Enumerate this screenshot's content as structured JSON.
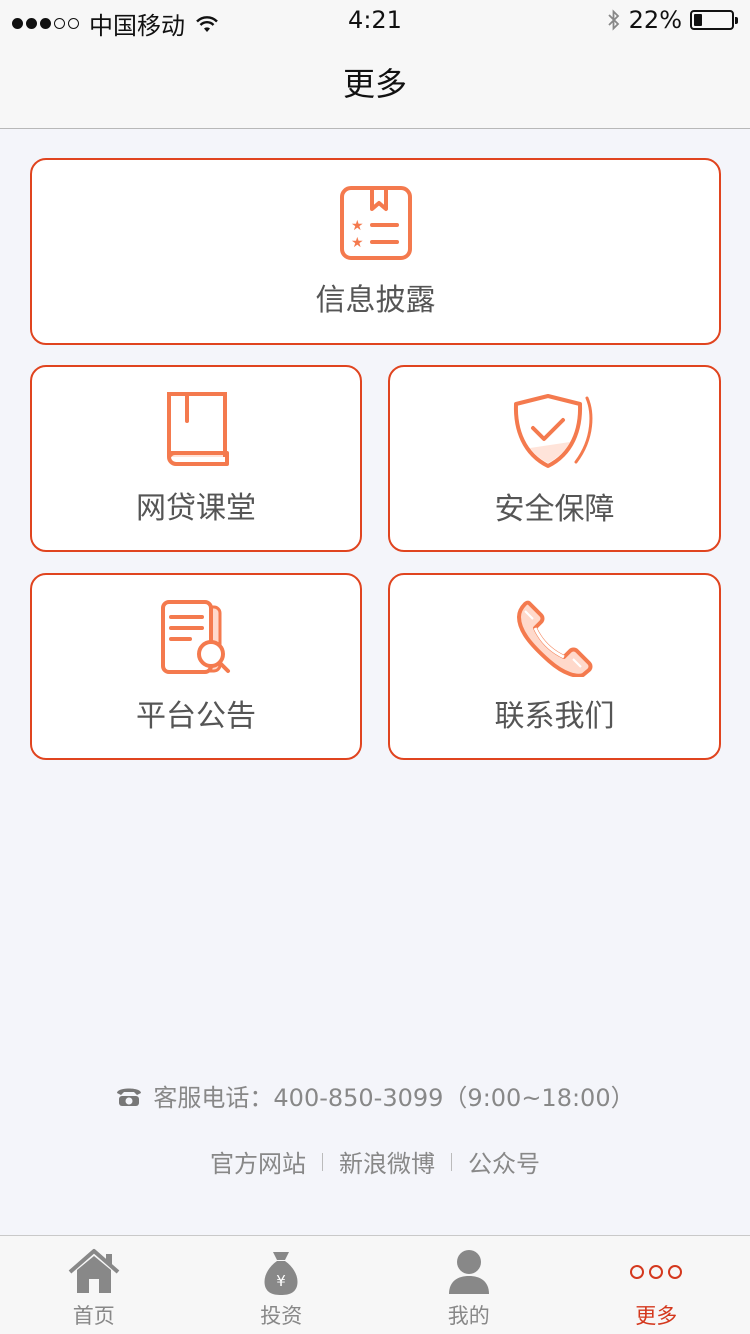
{
  "status_bar": {
    "carrier": "中国移动",
    "time": "4:21",
    "battery": "22%",
    "battery_level": 0.22
  },
  "nav": {
    "title": "更多"
  },
  "cards": {
    "disclosure": {
      "label": "信息披露",
      "icon": "disclosure-document-icon"
    },
    "classroom": {
      "label": "网贷课堂",
      "icon": "book-icon"
    },
    "security": {
      "label": "安全保障",
      "icon": "shield-check-icon"
    },
    "announcement": {
      "label": "平台公告",
      "icon": "document-search-icon"
    },
    "contact": {
      "label": "联系我们",
      "icon": "phone-icon"
    }
  },
  "footer": {
    "hotline": "客服电话：400-850-3099（9:00~18:00）",
    "links": [
      "官方网站",
      "新浪微博",
      "公众号"
    ]
  },
  "tabs": [
    {
      "label": "首页",
      "icon": "home-icon"
    },
    {
      "label": "投资",
      "icon": "money-bag-icon"
    },
    {
      "label": "我的",
      "icon": "user-icon"
    },
    {
      "label": "更多",
      "icon": "more-dots-icon",
      "active": true
    }
  ],
  "colors": {
    "accent": "#e0441f",
    "icon_orange": "#f47a4e",
    "background": "#f4f5fa"
  }
}
